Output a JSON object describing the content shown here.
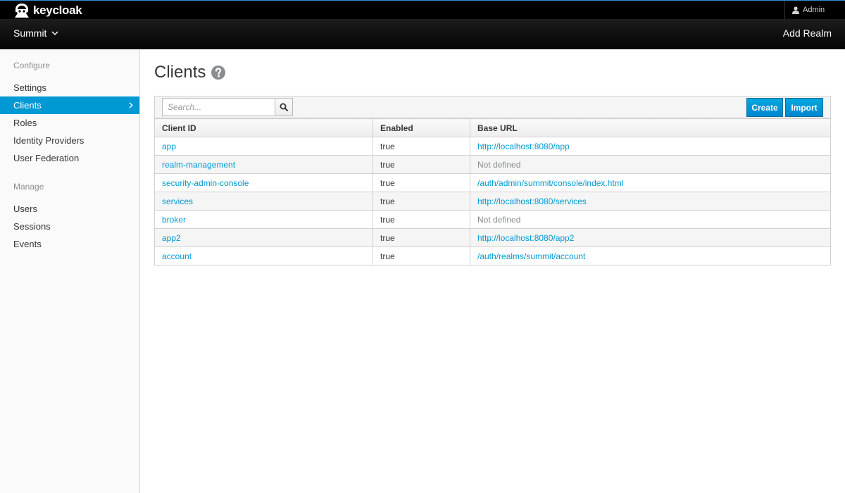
{
  "brand": {
    "name": "keycloak"
  },
  "user_menu": {
    "label": "Admin"
  },
  "realm": {
    "current": "Summit",
    "add_realm_label": "Add Realm"
  },
  "sidebar": {
    "configure_heading": "Configure",
    "configure_items": [
      "Settings",
      "Clients",
      "Roles",
      "Identity Providers",
      "User Federation"
    ],
    "active_item": "Clients",
    "manage_heading": "Manage",
    "manage_items": [
      "Users",
      "Sessions",
      "Events"
    ]
  },
  "page": {
    "title": "Clients"
  },
  "toolbar": {
    "search_placeholder": "Search...",
    "create_label": "Create",
    "import_label": "Import"
  },
  "table": {
    "columns": [
      "Client ID",
      "Enabled",
      "Base URL"
    ],
    "rows": [
      {
        "client_id": "app",
        "enabled": "true",
        "base_url": "http://localhost:8080/app",
        "base_url_defined": true
      },
      {
        "client_id": "realm-management",
        "enabled": "true",
        "base_url": "Not defined",
        "base_url_defined": false
      },
      {
        "client_id": "security-admin-console",
        "enabled": "true",
        "base_url": "/auth/admin/summit/console/index.html",
        "base_url_defined": true
      },
      {
        "client_id": "services",
        "enabled": "true",
        "base_url": "http://localhost:8080/services",
        "base_url_defined": true
      },
      {
        "client_id": "broker",
        "enabled": "true",
        "base_url": "Not defined",
        "base_url_defined": false
      },
      {
        "client_id": "app2",
        "enabled": "true",
        "base_url": "http://localhost:8080/app2",
        "base_url_defined": true
      },
      {
        "client_id": "account",
        "enabled": "true",
        "base_url": "/auth/realms/summit/account",
        "base_url_defined": true
      }
    ]
  },
  "colors": {
    "accent": "#0099d3",
    "topbar": "#000000",
    "sidebar_bg": "#fafafa",
    "muted_text": "#8b8d8f"
  }
}
